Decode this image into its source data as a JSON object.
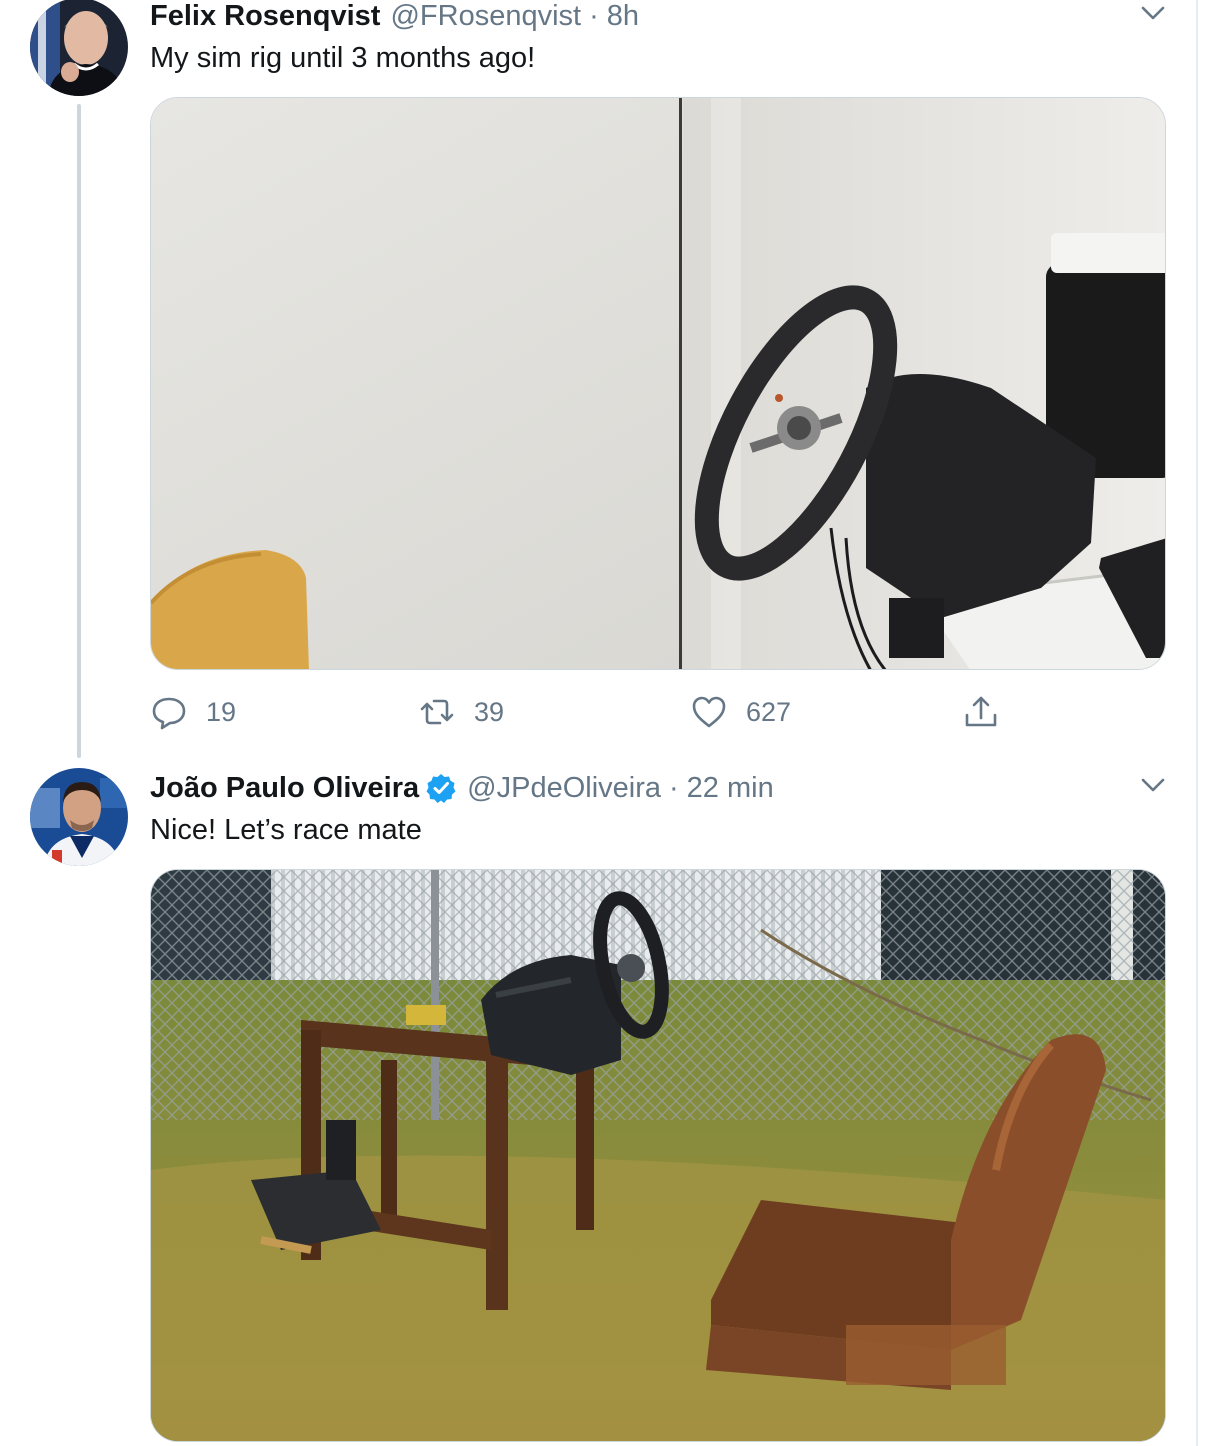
{
  "tweets": [
    {
      "display_name": "Felix Rosenqvist",
      "handle": "@FRosenqvist",
      "separator": "·",
      "time": "8h",
      "text": "My sim rig until 3 months ago!",
      "verified": false,
      "actions": {
        "replies": "19",
        "retweets": "39",
        "likes": "627"
      }
    },
    {
      "display_name": "João Paulo Oliveira",
      "handle": "@JPdeOliveira",
      "separator": "·",
      "time": "22 min",
      "text": "Nice! Let’s race mate",
      "verified": true
    }
  ],
  "icons": {
    "more": "chevron-down-icon",
    "reply": "reply-icon",
    "retweet": "retweet-icon",
    "like": "heart-icon",
    "share": "share-icon",
    "verified": "verified-badge-icon"
  },
  "colors": {
    "text_primary": "#14171a",
    "text_secondary": "#657786",
    "verified_blue": "#1da1f2",
    "thread_line": "#ccd6dd"
  }
}
